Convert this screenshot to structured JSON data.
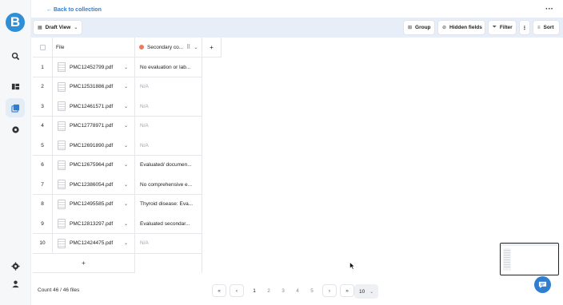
{
  "brand": {
    "logo_letter": "B",
    "accent": "#2f8fd6"
  },
  "header": {
    "back_label": "← Back to collection",
    "more_label": "···"
  },
  "toolbar": {
    "view_label": "Draft View",
    "group_label": "Group",
    "hidden_fields_label": "Hidden fields",
    "filter_label": "Filter",
    "more_label": "⋮",
    "sort_label": "Sort"
  },
  "table": {
    "columns": {
      "file": "File",
      "secondary": "Secondary co...",
      "add": "+"
    },
    "rows": [
      {
        "n": "1",
        "file": "PMC12452799.pdf",
        "secondary": "No evaluation or lab...",
        "na": false
      },
      {
        "n": "2",
        "file": "PMC12531886.pdf",
        "secondary": "N/A",
        "na": true
      },
      {
        "n": "3",
        "file": "PMC12461571.pdf",
        "secondary": "N/A",
        "na": true
      },
      {
        "n": "4",
        "file": "PMC12778971.pdf",
        "secondary": "N/A",
        "na": true
      },
      {
        "n": "5",
        "file": "PMC12691890.pdf",
        "secondary": "N/A",
        "na": true
      },
      {
        "n": "6",
        "file": "PMC12675964.pdf",
        "secondary": "Evaluated/ documen...",
        "na": false
      },
      {
        "n": "7",
        "file": "PMC12386054.pdf",
        "secondary": "No comprehensive e...",
        "na": false
      },
      {
        "n": "8",
        "file": "PMC12495585.pdf",
        "secondary": "Thyroid disease: Eva...",
        "na": false
      },
      {
        "n": "9",
        "file": "PMC12813297.pdf",
        "secondary": "Evaluated secondar...",
        "na": false
      },
      {
        "n": "10",
        "file": "PMC12424475.pdf",
        "secondary": "N/A",
        "na": true
      }
    ],
    "add_row_label": "+"
  },
  "footer": {
    "count_label": "Count 46 / 46 files",
    "pages": [
      "1",
      "2",
      "3",
      "4",
      "5"
    ],
    "current_page": "1",
    "first_label": "«",
    "prev_label": "‹",
    "next_label": "›",
    "last_label": "»",
    "page_size": "10"
  }
}
